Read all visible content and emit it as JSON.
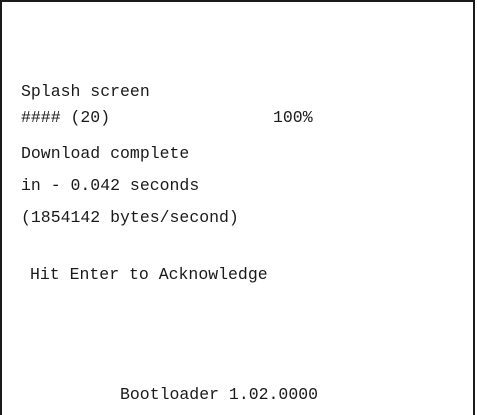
{
  "screen": {
    "title": "Splash screen",
    "progress_bar": "#### (20)",
    "progress_percent": "100%",
    "status": "Download complete",
    "elapsed": "in - 0.042 seconds",
    "rate": "(1854142 bytes/second)",
    "prompt": "Hit Enter to Acknowledge",
    "version": "Bootloader 1.02.0000"
  }
}
